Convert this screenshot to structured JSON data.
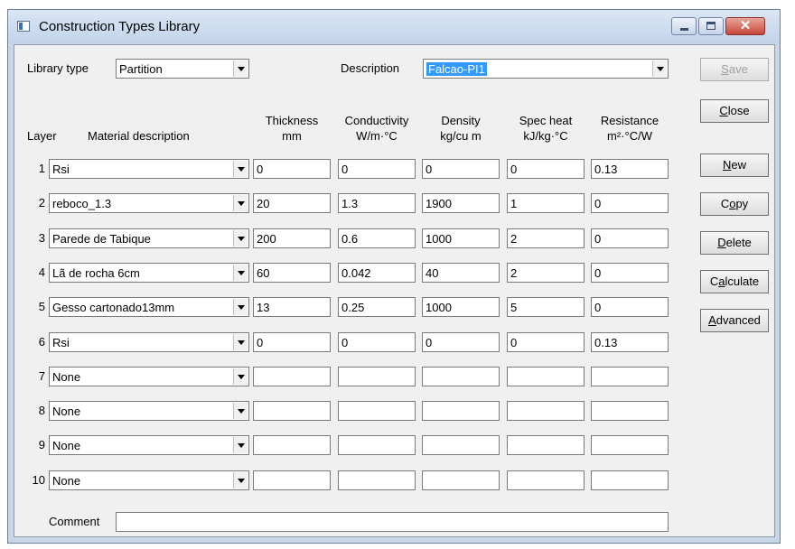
{
  "window": {
    "title": "Construction Types Library"
  },
  "library_type": {
    "label": "Library type",
    "value": "Partition"
  },
  "description": {
    "label": "Description",
    "value": "Falcao-PI1"
  },
  "columns": {
    "layer": "Layer",
    "material": "Material description",
    "thickness": [
      "Thickness",
      "mm"
    ],
    "conductivity": [
      "Conductivity",
      "W/m·°C"
    ],
    "density": [
      "Density",
      "kg/cu m"
    ],
    "spec_heat": [
      "Spec heat",
      "kJ/kg·°C"
    ],
    "resistance": [
      "Resistance",
      "m²·°C/W"
    ]
  },
  "layers": [
    {
      "num": "1",
      "material": "Rsi",
      "thickness": "0",
      "conductivity": "0",
      "density": "0",
      "spec_heat": "0",
      "resistance": "0.13"
    },
    {
      "num": "2",
      "material": "reboco_1.3",
      "thickness": "20",
      "conductivity": "1.3",
      "density": "1900",
      "spec_heat": "1",
      "resistance": "0"
    },
    {
      "num": "3",
      "material": "Parede de Tabique",
      "thickness": "200",
      "conductivity": "0.6",
      "density": "1000",
      "spec_heat": "2",
      "resistance": "0"
    },
    {
      "num": "4",
      "material": "Lã de rocha 6cm",
      "thickness": "60",
      "conductivity": "0.042",
      "density": "40",
      "spec_heat": "2",
      "resistance": "0"
    },
    {
      "num": "5",
      "material": "Gesso cartonado13mm",
      "thickness": "13",
      "conductivity": "0.25",
      "density": "1000",
      "spec_heat": "5",
      "resistance": "0"
    },
    {
      "num": "6",
      "material": "Rsi",
      "thickness": "0",
      "conductivity": "0",
      "density": "0",
      "spec_heat": "0",
      "resistance": "0.13"
    },
    {
      "num": "7",
      "material": "None",
      "thickness": "",
      "conductivity": "",
      "density": "",
      "spec_heat": "",
      "resistance": ""
    },
    {
      "num": "8",
      "material": "None",
      "thickness": "",
      "conductivity": "",
      "density": "",
      "spec_heat": "",
      "resistance": ""
    },
    {
      "num": "9",
      "material": "None",
      "thickness": "",
      "conductivity": "",
      "density": "",
      "spec_heat": "",
      "resistance": ""
    },
    {
      "num": "10",
      "material": "None",
      "thickness": "",
      "conductivity": "",
      "density": "",
      "spec_heat": "",
      "resistance": ""
    }
  ],
  "buttons": [
    {
      "key": "save",
      "label": "Save",
      "accel": "S",
      "enabled": false
    },
    {
      "key": "close",
      "label": "Close",
      "accel": "C",
      "enabled": true
    },
    {
      "key": "new",
      "label": "New",
      "accel": "N",
      "enabled": true
    },
    {
      "key": "copy",
      "label": "Copy",
      "accel": "o",
      "enabled": true
    },
    {
      "key": "delete",
      "label": "Delete",
      "accel": "D",
      "enabled": true
    },
    {
      "key": "calculate",
      "label": "Calculate",
      "accel": "a",
      "enabled": true
    },
    {
      "key": "advanced",
      "label": "Advanced",
      "accel": "A",
      "enabled": true
    }
  ],
  "comment": {
    "label": "Comment",
    "value": ""
  },
  "icons": [
    "app-icon",
    "minimize-icon",
    "maximize-icon",
    "close-icon",
    "dropdown-arrow-icon"
  ]
}
